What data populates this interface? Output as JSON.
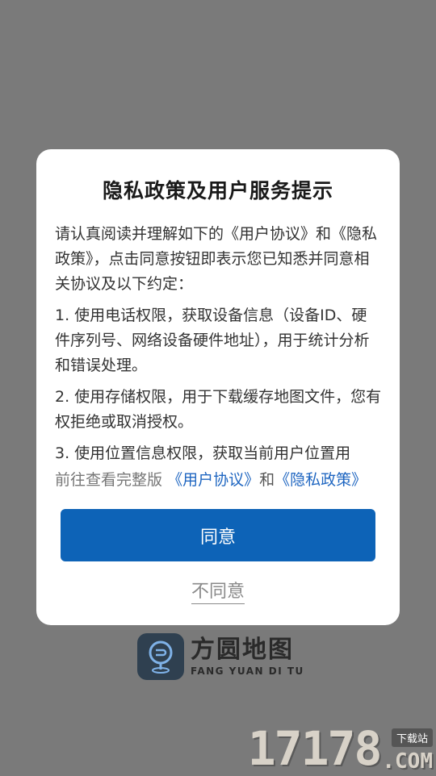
{
  "dialog": {
    "title": "隐私政策及用户服务提示",
    "intro": "请认真阅读并理解如下的《用户协议》和《隐私政策》，点击同意按钮即表示您已知悉并同意相关协议及以下约定：",
    "items": [
      "1. 使用电话权限，获取设备信息（设备ID、硬件序列号、网络设备硬件地址），用于统计分析和错误处理。",
      "2. 使用存储权限，用于下载缓存地图文件，您有权拒绝或取消授权。",
      "3. 使用位置信息权限，获取当前用户位置用"
    ],
    "more_prefix": "前往查看完整版",
    "user_agreement_link": "《用户协议》",
    "and_text": "和",
    "privacy_policy_link": "《隐私政策》",
    "agree_label": "同意",
    "disagree_label": "不同意"
  },
  "logo": {
    "name_cn": "方圆地图",
    "name_en": "FANG YUAN DI TU"
  },
  "watermark": {
    "number": "17178",
    "tag": "下载站",
    "suffix": ".COM"
  },
  "colors": {
    "accent": "#0d63b7",
    "link": "#1f66c1",
    "overlay": "#7a7a7a"
  }
}
